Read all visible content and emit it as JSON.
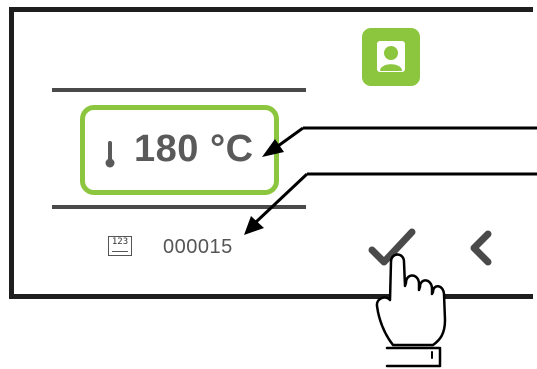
{
  "temperature": {
    "value": "180 °C"
  },
  "counter": {
    "icon_label": "123",
    "value": "000015"
  },
  "icons": {
    "user": "user-icon",
    "thermometer": "thermometer-icon",
    "counter": "counter-icon",
    "confirm": "check-icon",
    "back": "chevron-left-icon",
    "hand": "pointing-hand-icon"
  },
  "colors": {
    "accent": "#8cc63f",
    "text": "#5a5a5a",
    "frame": "#1e1e1e"
  }
}
